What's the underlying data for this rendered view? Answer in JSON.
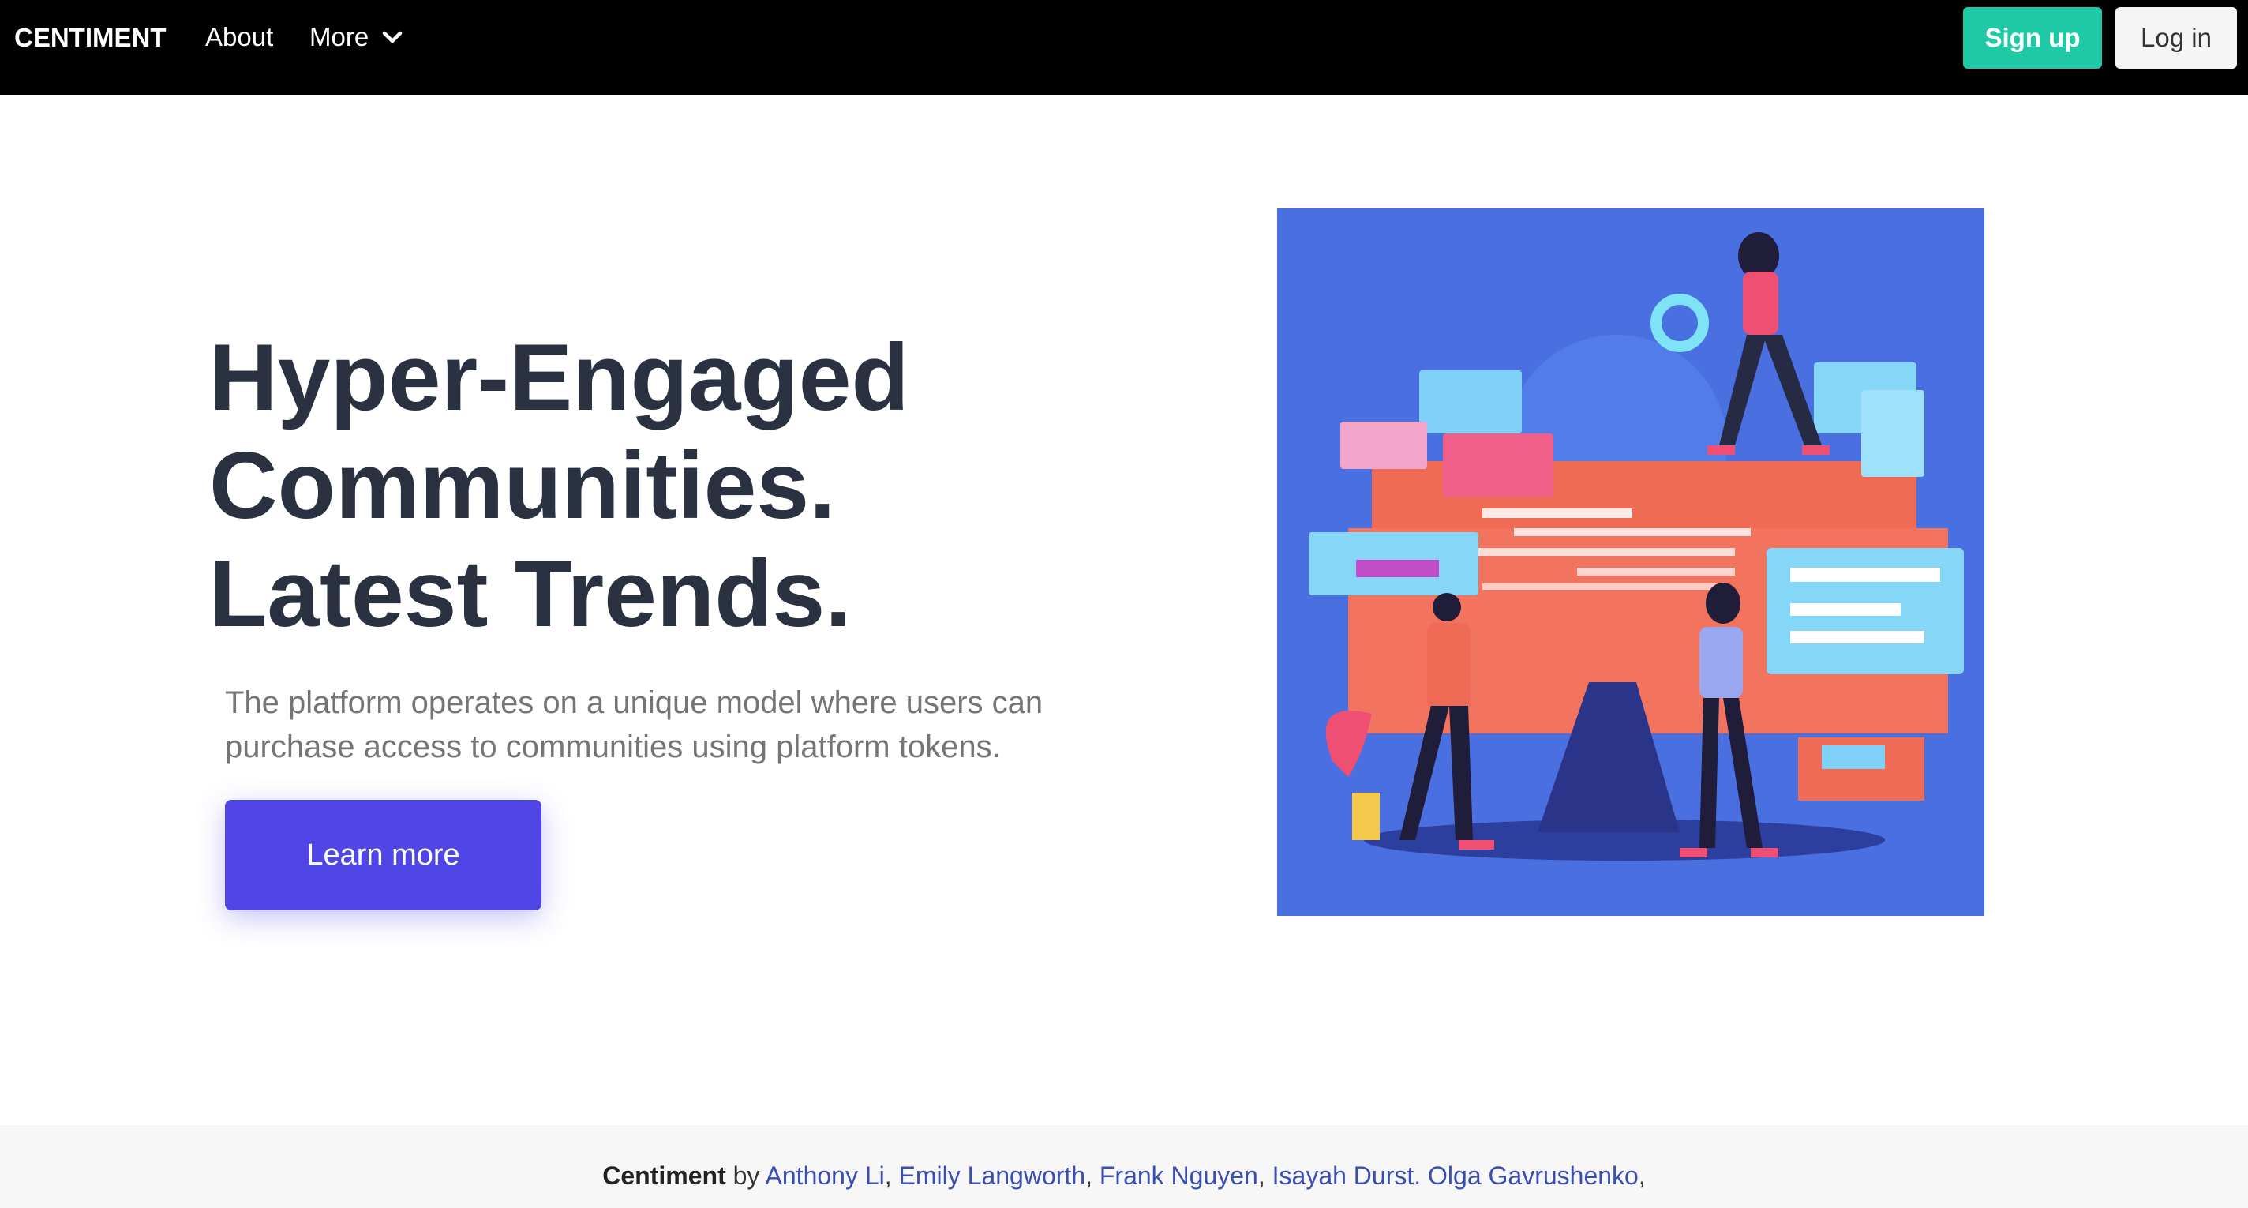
{
  "navbar": {
    "brand": "CENTIMENT",
    "about_label": "About",
    "more_label": "More",
    "signup_label": "Sign up",
    "login_label": "Log in"
  },
  "hero": {
    "title_lines": [
      "Hyper-Engaged",
      "Communities.",
      "Latest Trends."
    ],
    "subtitle_line1": "The platform operates on a unique model where users can",
    "subtitle_line2": "purchase access to communities using platform tokens.",
    "cta_label": "Learn more"
  },
  "footer": {
    "brand": "Centiment",
    "by": " by ",
    "authors": [
      "Anthony Li",
      "Emily Langworth",
      "Frank Nguyen",
      "Isayah Durst. Olga Gavrushenko"
    ],
    "sep": ", ",
    "trailing": ","
  },
  "colors": {
    "navbar_bg": "#000000",
    "signup_bg": "#20c9a6",
    "login_bg": "#f5f5f5",
    "title_text": "#2a3241",
    "cta_bg": "#4f46e5",
    "illustration_bg": "#4a6fe0",
    "author_link": "#3a4db3"
  }
}
